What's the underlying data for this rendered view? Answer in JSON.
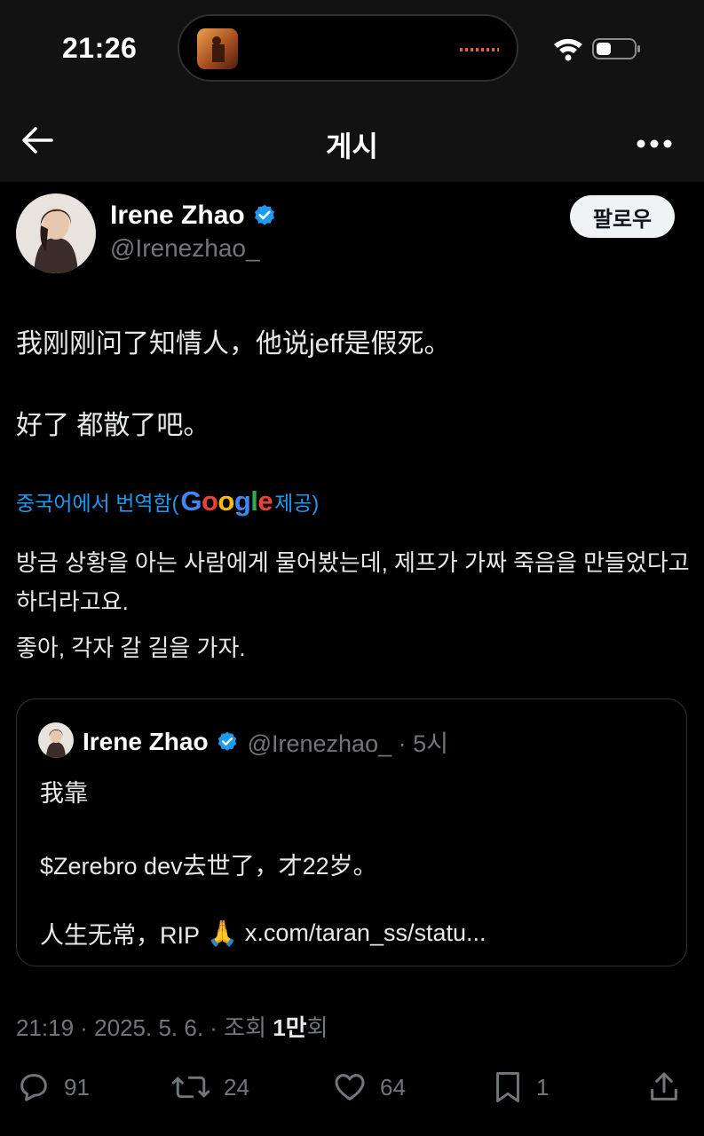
{
  "status_bar": {
    "time": "21:26"
  },
  "nav": {
    "title": "게시"
  },
  "author": {
    "name": "Irene Zhao",
    "handle": "@Irenezhao_",
    "follow_label": "팔로우"
  },
  "post": {
    "lines": [
      "我刚刚问了知情人，他说jeff是假死。",
      "好了 都散了吧。"
    ],
    "translation": {
      "label_before": "중국어에서 번역함(",
      "google": [
        "G",
        "o",
        "o",
        "g",
        "l",
        "e"
      ],
      "label_after": " 제공)",
      "paragraphs": [
        "방금 상황을 아는 사람에게 물어봤는데, 제프가 가짜 죽음을 만들었다고 하더라고요.",
        "좋아, 각자 갈 길을 가자."
      ]
    }
  },
  "quote": {
    "name": "Irene Zhao",
    "handle_time": "@Irenezhao_ · 5시",
    "lines": [
      "我靠",
      "$Zerebro dev去世了，才22岁。",
      "人生无常，RIP",
      "x.com/taran_ss/statu..."
    ],
    "emoji": "🙏"
  },
  "meta": {
    "prefix": "21:19 · 2025. 5. 6. · 조회 ",
    "views": "1만",
    "suffix": "회"
  },
  "actions": {
    "replies": "91",
    "reposts": "24",
    "likes": "64",
    "bookmarks": "1"
  },
  "colors": {
    "accent": "#1d9bf0",
    "verified": "#1d9bf0",
    "background": "#000000",
    "muted": "#71767b",
    "google_blue": "#4285f4",
    "google_red": "#ea4335",
    "google_yellow": "#fbbc05",
    "google_green": "#34a853"
  },
  "icons": [
    "back-arrow-icon",
    "more-icon",
    "wifi-icon",
    "battery-icon",
    "verified-badge-icon",
    "reply-icon",
    "repost-icon",
    "like-icon",
    "bookmark-icon",
    "share-icon",
    "folded-hands-emoji"
  ]
}
